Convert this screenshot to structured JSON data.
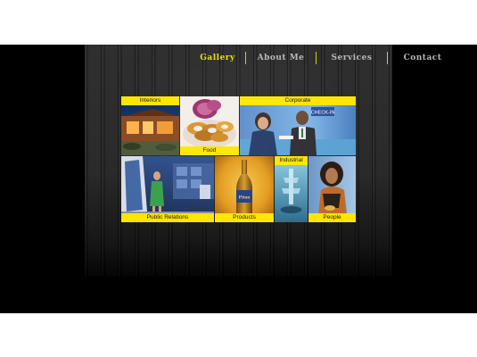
{
  "nav": {
    "items": [
      {
        "label": "Gallery",
        "active": true
      },
      {
        "label": "About Me",
        "active": false
      },
      {
        "label": "Services",
        "active": false
      },
      {
        "label": "Contact",
        "active": false
      }
    ]
  },
  "gallery": {
    "tiles": [
      {
        "key": "interiors",
        "label": "Interiors"
      },
      {
        "key": "food",
        "label": "Food"
      },
      {
        "key": "corporate",
        "label": "Corporate",
        "sign_text": "CHECK-IN"
      },
      {
        "key": "public_relations",
        "label": "Public Relations"
      },
      {
        "key": "products",
        "label": "Products",
        "bottle_text": "Piton"
      },
      {
        "key": "industrial",
        "label": "Industrial"
      },
      {
        "key": "people",
        "label": "People"
      }
    ]
  },
  "colors": {
    "accent": "#ffe600",
    "nav_active": "#e9e000",
    "nav_inactive": "#b8b8b8"
  }
}
